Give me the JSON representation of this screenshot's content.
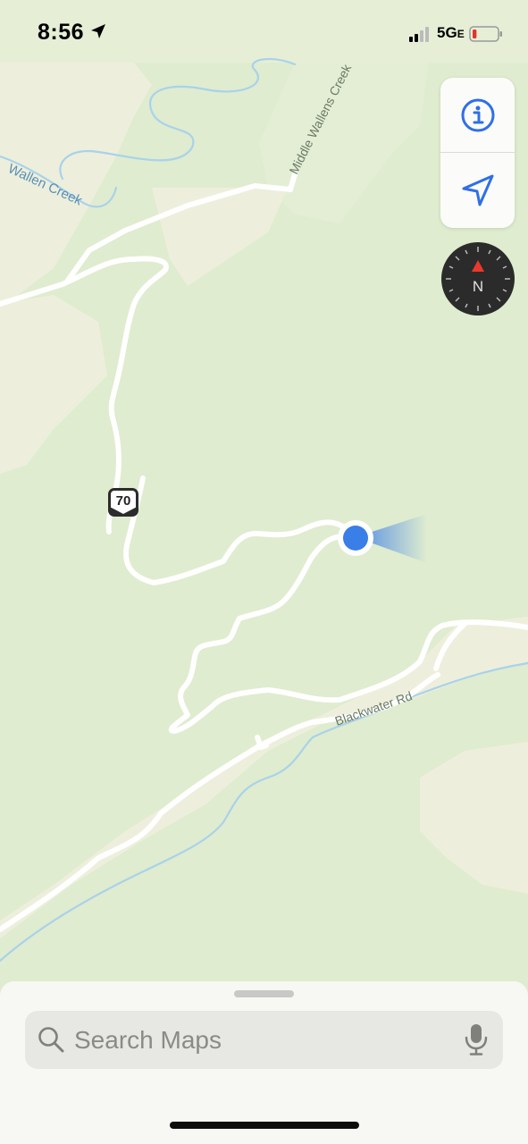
{
  "status_bar": {
    "time": "8:56",
    "network": "5G",
    "network_suffix": "E",
    "battery_level": 0.12
  },
  "map": {
    "labels": {
      "wallen_creek": "Wallen Creek",
      "middle_wallens_creek": "Middle Wallens Creek",
      "blackwater_rd": "Blackwater Rd"
    },
    "route_shield": "70",
    "compass_heading_label": "N"
  },
  "controls": {
    "info_icon": "info-icon",
    "locate_icon": "location-arrow-icon",
    "compass_icon": "compass-icon"
  },
  "search": {
    "placeholder": "Search Maps",
    "value": ""
  },
  "colors": {
    "map_green": "#dfeccf",
    "map_tan": "#edefdc",
    "water": "#a9d2ea",
    "user_location": "#3a7ee8",
    "accent": "#2f6fe8"
  }
}
